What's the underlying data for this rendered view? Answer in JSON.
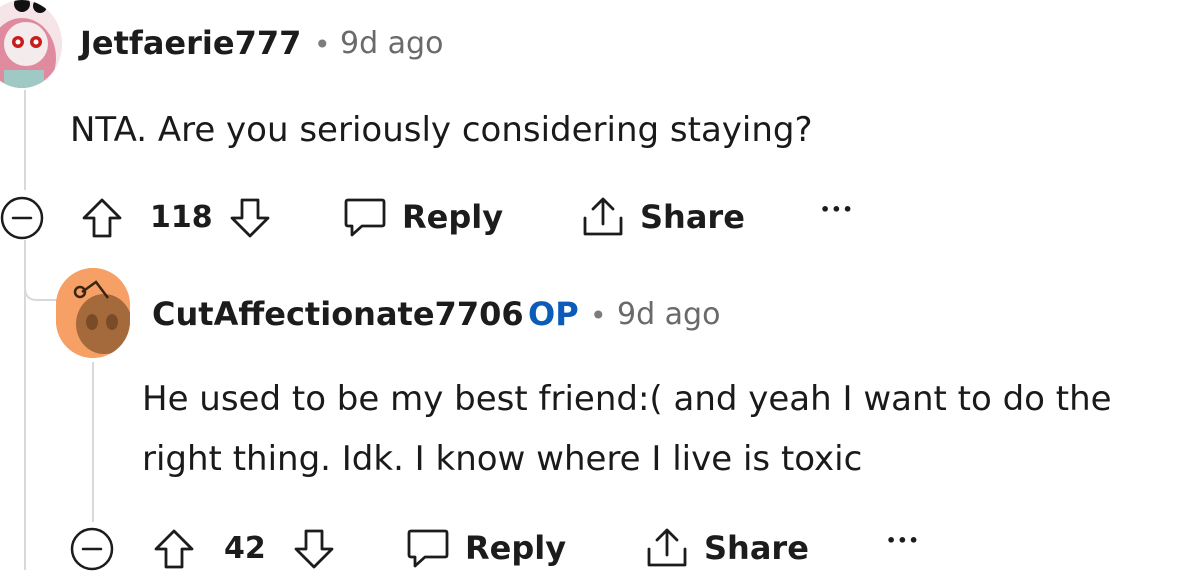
{
  "comments": [
    {
      "author": "Jetfaerie777",
      "is_op": false,
      "op_label": "",
      "separator": "•",
      "time": "9d ago",
      "lines": [
        "NTA. Are you seriously considering staying?"
      ],
      "score": "118",
      "reply_label": "Reply",
      "share_label": "Share",
      "more_label": "•••",
      "avatar": "pink-haired-snoo-avatar"
    },
    {
      "author": "CutAffectionate7706",
      "is_op": true,
      "op_label": "OP",
      "separator": "•",
      "time": "9d ago",
      "lines": [
        "He used to be my best friend:( and yeah I want to do the",
        "right thing. Idk. I know where I live is toxic"
      ],
      "score": "42",
      "reply_label": "Reply",
      "share_label": "Share",
      "more_label": "•••",
      "avatar": "default-snoo-avatar"
    }
  ],
  "colors": {
    "op_blue": "#0a5cb8",
    "meta_gray": "#6a6a6a",
    "thread_line": "#d7dadc",
    "avatar1_bg": "#e9c6cf",
    "avatar2_bg": "#f7a066"
  }
}
